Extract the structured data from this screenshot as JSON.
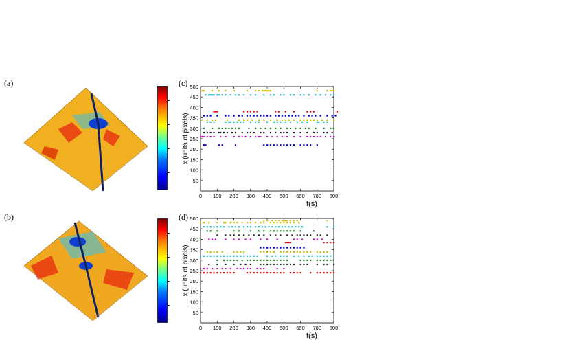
{
  "labels": {
    "a": "(a)",
    "b": "(b)",
    "c": "(c)",
    "d": "(d)"
  },
  "colormap": [
    "#00008f",
    "#0000ff",
    "#0080ff",
    "#00ffff",
    "#80ff80",
    "#ffff00",
    "#ff8000",
    "#ff0000",
    "#800000"
  ],
  "chart_data": [
    {
      "panel": "(c)",
      "type": "scatter",
      "xlabel": "t(s)",
      "ylabel": "x (units of pixels)",
      "xlim": [
        0,
        800
      ],
      "ylim": [
        0,
        500
      ],
      "xticks": [
        0,
        100,
        200,
        300,
        400,
        500,
        600,
        700,
        800
      ],
      "xtick_labels": [
        "0",
        "100",
        "200",
        "300",
        "400",
        "500",
        "600",
        "700",
        "800"
      ],
      "yticks": [
        50,
        100,
        150,
        200,
        250,
        300,
        350,
        400,
        450,
        500
      ],
      "grid": false,
      "series": [
        {
          "color": "#d4b800",
          "y": 480,
          "x": [
            10,
            20,
            70,
            110,
            150,
            200,
            280,
            330,
            350,
            370,
            380,
            390,
            400,
            410,
            420,
            700,
            760,
            780,
            790,
            800
          ]
        },
        {
          "color": "#20b8c8",
          "y": 460,
          "x": [
            30,
            50,
            60,
            70,
            80,
            100,
            110,
            130,
            150,
            180,
            210,
            230,
            260,
            300,
            330,
            380,
            420,
            440,
            480,
            500,
            540,
            560,
            600,
            620,
            650,
            690,
            720,
            750,
            780,
            800
          ]
        },
        {
          "color": "#e00000",
          "y": 380,
          "x": [
            80,
            90,
            100,
            260,
            280,
            300,
            320,
            340,
            450,
            470,
            510,
            560,
            640,
            660,
            680,
            820
          ]
        },
        {
          "color": "#0000c8",
          "y": 360,
          "x": [
            20,
            40,
            60,
            100,
            150,
            170,
            200,
            230,
            250,
            280,
            300,
            320,
            340,
            360,
            380,
            400,
            420,
            450,
            470,
            490,
            510,
            530,
            550,
            570,
            590,
            620,
            650,
            670,
            690,
            720,
            760,
            790,
            810
          ]
        },
        {
          "color": "#c8b400",
          "y": 340,
          "x": [
            10,
            40,
            70,
            90,
            160,
            230,
            260,
            280,
            310,
            350,
            380,
            420,
            460,
            490,
            510,
            530,
            560,
            600,
            620,
            640,
            660,
            680,
            700,
            730,
            760,
            800
          ]
        },
        {
          "color": "#20b8b8",
          "y": 330,
          "x": [
            40,
            60,
            80,
            150,
            170,
            180,
            200,
            220,
            240,
            260,
            300,
            330,
            350,
            400,
            440,
            460,
            480,
            510,
            540,
            580,
            610,
            640,
            700,
            710,
            740,
            760
          ]
        },
        {
          "color": "#208020",
          "y": 300,
          "x": [
            20,
            70,
            110,
            130,
            150,
            170,
            190,
            210,
            230,
            290,
            330,
            360,
            390,
            420,
            450,
            480,
            520,
            540,
            570,
            600,
            630,
            650,
            690,
            740,
            780,
            800
          ]
        },
        {
          "color": "#202020",
          "y": 280,
          "x": [
            20,
            40,
            60,
            80,
            110,
            120,
            140,
            160,
            190,
            210,
            250,
            280,
            300,
            320,
            360,
            380,
            420,
            450,
            480,
            500,
            520,
            560,
            600,
            640,
            680,
            700,
            740,
            760,
            790
          ]
        },
        {
          "color": "#d000d0",
          "y": 260,
          "x": [
            0,
            10,
            20,
            40,
            60,
            80,
            120,
            150,
            200,
            230,
            250,
            270,
            300,
            330,
            350,
            360,
            400,
            430,
            460,
            490,
            520,
            560,
            600,
            640,
            660,
            680,
            700,
            720,
            750,
            780,
            800
          ]
        },
        {
          "color": "#0000c8",
          "y": 220,
          "x": [
            20,
            30,
            110,
            130,
            210,
            380,
            400,
            420,
            440,
            460,
            480,
            500,
            520,
            540,
            560,
            600,
            620,
            640,
            660,
            700
          ]
        }
      ]
    },
    {
      "panel": "(d)",
      "type": "scatter",
      "xlabel": "t(s)",
      "ylabel": "x (units of pixels)",
      "xlim": [
        0,
        800
      ],
      "ylim": [
        0,
        500
      ],
      "xticks": [
        0,
        100,
        200,
        300,
        400,
        500,
        600,
        700,
        800
      ],
      "xtick_labels": [
        "0",
        "100",
        "200",
        "300",
        "400",
        "500",
        "600",
        "700",
        "800"
      ],
      "yticks": [
        50,
        100,
        150,
        200,
        250,
        300,
        350,
        400,
        450,
        500
      ],
      "grid": false,
      "series": [
        {
          "color": "#d4b800",
          "y": 490,
          "x": [
            380,
            400,
            430,
            450,
            470,
            490,
            500,
            510,
            520,
            540,
            560,
            580,
            760
          ]
        },
        {
          "color": "#d4b800",
          "y": 480,
          "x": [
            0,
            20,
            50,
            100,
            140,
            150,
            180,
            200,
            220,
            250,
            280,
            300,
            330,
            360,
            380,
            420,
            440,
            460,
            480,
            500,
            520,
            540,
            560,
            590
          ]
        },
        {
          "color": "#20b8c8",
          "y": 460,
          "x": [
            20,
            40,
            60,
            80,
            100,
            120,
            140,
            170,
            190,
            210,
            230,
            260,
            280,
            300,
            330,
            350,
            370,
            390,
            410,
            430,
            450,
            470,
            490,
            510,
            530,
            550,
            570,
            590,
            610,
            760,
            800
          ]
        },
        {
          "color": "#208020",
          "y": 440,
          "x": [
            40,
            60,
            100,
            200,
            230,
            300,
            350,
            380,
            420,
            440,
            460,
            480,
            500,
            520,
            540,
            560,
            600,
            680
          ]
        },
        {
          "color": "#202020",
          "y": 420,
          "x": [
            100,
            150,
            180,
            200,
            230,
            260,
            290,
            320,
            350,
            380,
            420,
            450,
            480,
            520,
            550,
            580,
            600,
            620,
            640,
            660,
            700,
            720,
            760
          ]
        },
        {
          "color": "#d000d0",
          "y": 400,
          "x": [
            50,
            70,
            90,
            150,
            200,
            230,
            270,
            300,
            360,
            400,
            460,
            560,
            580,
            610,
            680,
            700,
            730
          ]
        },
        {
          "color": "#e00000",
          "y": 385,
          "x": [
            510,
            520,
            530,
            540,
            740,
            760,
            780,
            800
          ]
        },
        {
          "color": "#0000c8",
          "y": 360,
          "x": [
            360,
            380,
            400,
            420,
            440,
            460,
            480,
            500,
            520,
            540,
            560,
            580,
            600,
            620
          ]
        },
        {
          "color": "#c8b400",
          "y": 340,
          "x": [
            40,
            60,
            80,
            100,
            130,
            200,
            220,
            240,
            260,
            360,
            380,
            400,
            420,
            440,
            480,
            500,
            520,
            540,
            560,
            580,
            600,
            620,
            640,
            660,
            700,
            720,
            740,
            760
          ]
        },
        {
          "color": "#20b8c8",
          "y": 320,
          "x": [
            0,
            20,
            40,
            60,
            80,
            100,
            120,
            140,
            160,
            180,
            200,
            220,
            240,
            260,
            280,
            300,
            320,
            340,
            400,
            430,
            450,
            480,
            500,
            520,
            560,
            590,
            620,
            650,
            670,
            700,
            720,
            740,
            760,
            780
          ]
        },
        {
          "color": "#208020",
          "y": 300,
          "x": [
            100,
            140,
            160,
            180,
            200,
            220,
            250,
            280,
            300,
            320,
            340,
            360,
            380,
            400,
            420,
            440,
            460,
            480,
            500,
            520,
            600,
            620,
            640,
            660,
            700,
            720,
            740,
            760,
            780
          ]
        },
        {
          "color": "#202020",
          "y": 280,
          "x": [
            50,
            100,
            150,
            200,
            240,
            270,
            300,
            360,
            380,
            400,
            420,
            440,
            460,
            480,
            500,
            520,
            540,
            560,
            600,
            620,
            640,
            700,
            740,
            760,
            800
          ]
        },
        {
          "color": "#d000d0",
          "y": 260,
          "x": [
            0,
            20,
            40,
            70,
            100,
            130,
            150,
            180,
            220,
            240,
            260,
            280,
            300,
            340,
            360,
            380,
            460,
            500
          ]
        },
        {
          "color": "#e00000",
          "y": 240,
          "x": [
            0,
            20,
            40,
            60,
            80,
            100,
            120,
            140,
            160,
            180,
            200,
            280,
            300,
            320,
            340,
            360,
            380,
            400,
            420,
            440,
            460,
            480,
            500,
            540,
            560,
            580,
            600,
            660,
            700,
            720,
            740,
            760,
            780,
            800
          ]
        }
      ]
    }
  ]
}
